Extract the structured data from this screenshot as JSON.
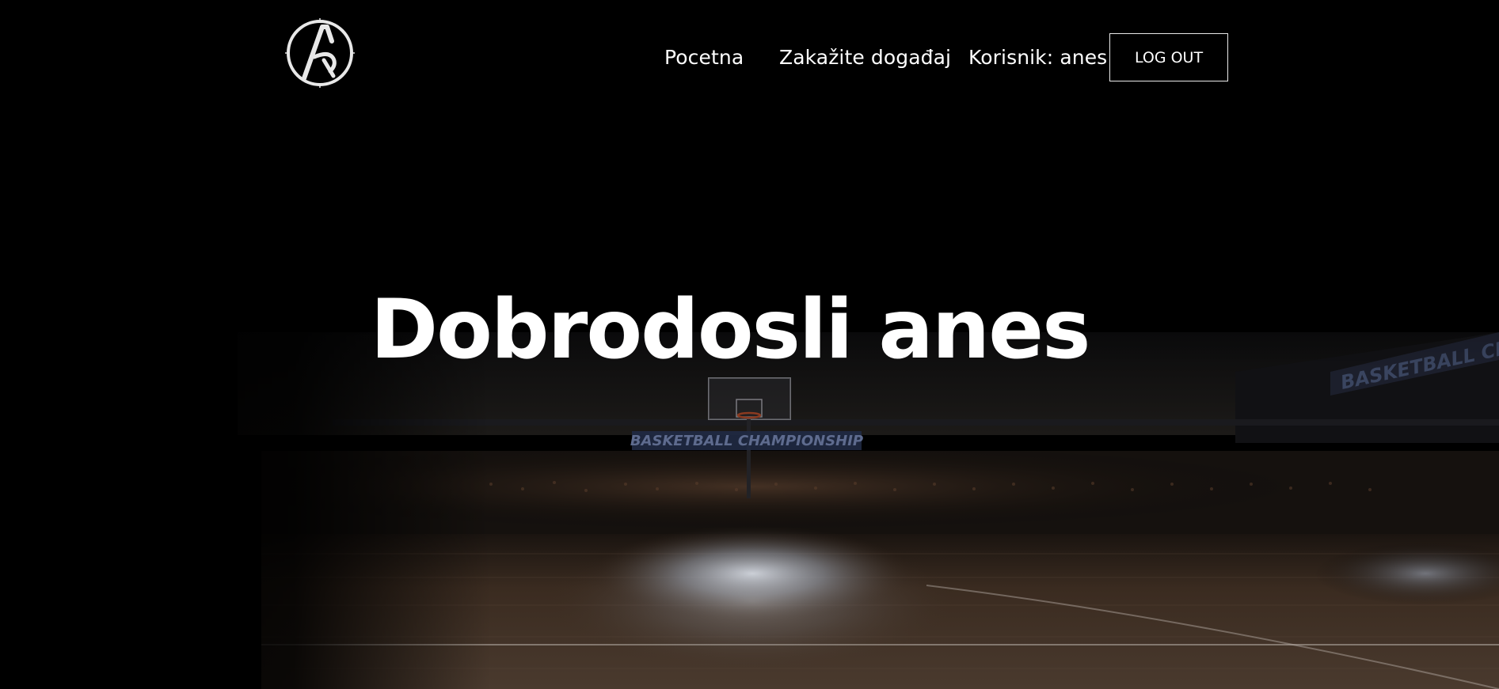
{
  "logo": {
    "icon": "letter-a-circle-logo",
    "color": "#e8e8e8"
  },
  "nav": {
    "home_label": "Pocetna",
    "schedule_label": "Zakažite događaj",
    "user_label": "Korisnik: anes",
    "logout_label": "LOG OUT"
  },
  "hero": {
    "title": "Dobrodosli anes",
    "background": "basketball-arena-image",
    "banner_text": "BASKETBALL CHAMPIONSHIP"
  },
  "colors": {
    "background": "#000000",
    "text": "#ffffff",
    "button_border": "#eaeaea",
    "court": "#3a2a1f"
  }
}
